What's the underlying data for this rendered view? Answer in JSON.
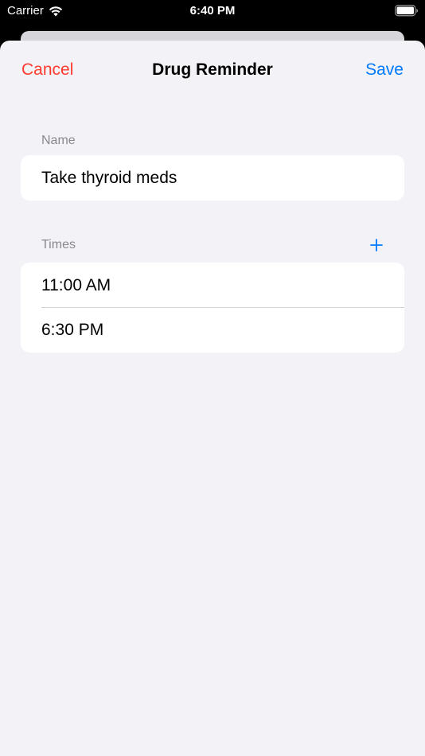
{
  "status_bar": {
    "carrier": "Carrier",
    "time": "6:40 PM",
    "wifi_icon": "wifi-icon",
    "battery_icon": "battery-icon"
  },
  "nav": {
    "cancel_label": "Cancel",
    "title": "Drug Reminder",
    "save_label": "Save"
  },
  "name_section": {
    "header": "Name",
    "value": "Take thyroid meds"
  },
  "times_section": {
    "header": "Times",
    "add_icon": "plus-icon",
    "times": [
      "11:00 AM",
      "6:30 PM"
    ]
  },
  "colors": {
    "cancel": "#ff3b30",
    "accent": "#007aff",
    "background": "#f2f2f7",
    "secondary_text": "#8a8a8e"
  }
}
